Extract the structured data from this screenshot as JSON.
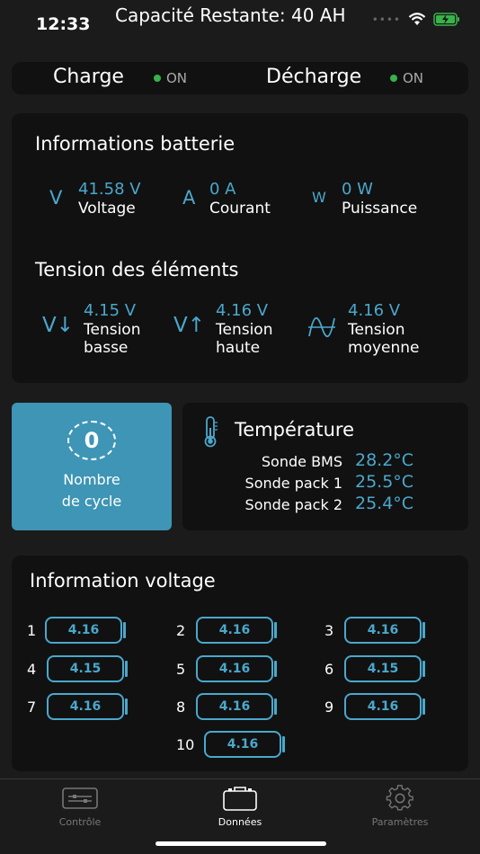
{
  "status": {
    "time": "12:33",
    "title": "Capacité Restante: 40 AH"
  },
  "charge": {
    "label": "Charge",
    "state": "ON"
  },
  "discharge": {
    "label": "Décharge",
    "state": "ON"
  },
  "battery": {
    "title": "Informations batterie",
    "voltage": {
      "icon": "V",
      "value": "41.58 V",
      "label": "Voltage"
    },
    "current": {
      "icon": "A",
      "value": "0 A",
      "label": "Courant"
    },
    "power": {
      "icon": "W",
      "value": "0 W",
      "label": "Puissance"
    }
  },
  "cells_tension": {
    "title": "Tension des éléments",
    "low": {
      "icon": "V↓",
      "value": "4.15 V",
      "label1": "Tension",
      "label2": "basse"
    },
    "high": {
      "icon": "V↑",
      "value": "4.16 V",
      "label1": "Tension",
      "label2": "haute"
    },
    "avg": {
      "value": "4.16 V",
      "label1": "Tension",
      "label2": "moyenne"
    }
  },
  "cycle": {
    "count": "0",
    "label1": "Nombre",
    "label2": "de cycle"
  },
  "temperature": {
    "title": "Température",
    "probes": [
      {
        "name": "Sonde BMS",
        "value": "28.2°C"
      },
      {
        "name": "Sonde pack 1",
        "value": "25.5°C"
      },
      {
        "name": "Sonde pack 2",
        "value": "25.4°C"
      }
    ]
  },
  "voltage_info": {
    "title": "Information voltage",
    "cells": [
      {
        "idx": "1",
        "value": "4.16"
      },
      {
        "idx": "2",
        "value": "4.16"
      },
      {
        "idx": "3",
        "value": "4.16"
      },
      {
        "idx": "4",
        "value": "4.15"
      },
      {
        "idx": "5",
        "value": "4.16"
      },
      {
        "idx": "6",
        "value": "4.15"
      },
      {
        "idx": "7",
        "value": "4.16"
      },
      {
        "idx": "8",
        "value": "4.16"
      },
      {
        "idx": "9",
        "value": "4.16"
      },
      {
        "idx": "10",
        "value": "4.16"
      }
    ]
  },
  "tabs": [
    {
      "label": "Contrôle",
      "icon": "control-panel-icon"
    },
    {
      "label": "Données",
      "icon": "briefcase-icon"
    },
    {
      "label": "Paramètres",
      "icon": "gear-icon"
    }
  ],
  "colors": {
    "accent": "#4aa8cc",
    "on": "#37b34a",
    "background": "#1b1b1b",
    "card": "#111111"
  }
}
